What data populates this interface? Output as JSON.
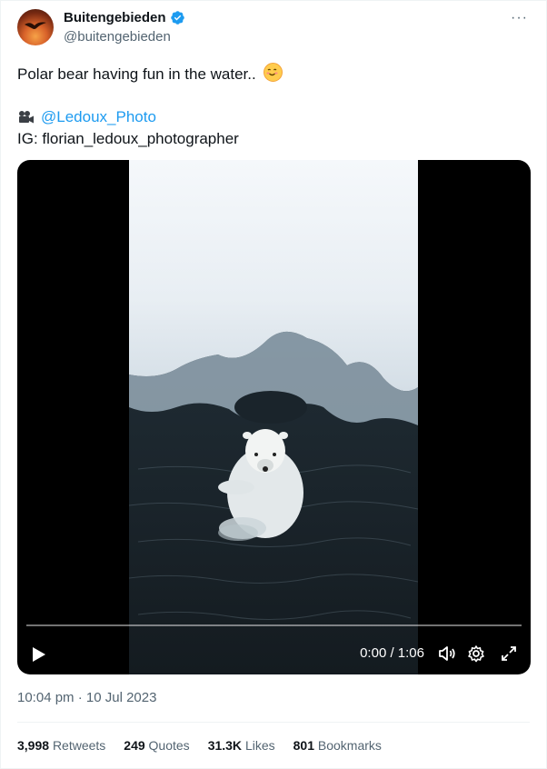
{
  "tweet": {
    "author": {
      "display_name": "Buitengebieden",
      "handle": "@buitengebieden",
      "verified_icon": "verified-badge-icon"
    },
    "more_label": "···",
    "text_line1": "Polar bear having fun in the water..",
    "camera_icon": "movie-camera-icon",
    "mention": "@Ledoux_Photo",
    "ig_line": "IG: florian_ledoux_photographer",
    "timestamp": "10:04 pm · 10 Jul 2023"
  },
  "video": {
    "time_display": "0:00 / 1:06",
    "progress": 0.0,
    "controls": {
      "play_icon": "play-icon",
      "volume_icon": "volume-icon",
      "settings_icon": "gear-icon",
      "fullscreen_icon": "fullscreen-icon"
    }
  },
  "stats": [
    {
      "count": "3,998",
      "label": "Retweets"
    },
    {
      "count": "249",
      "label": "Quotes"
    },
    {
      "count": "31.3K",
      "label": "Likes"
    },
    {
      "count": "801",
      "label": "Bookmarks"
    }
  ],
  "colors": {
    "accent": "#1d9bf0",
    "secondary_text": "#536471",
    "primary_text": "#0f1419"
  }
}
